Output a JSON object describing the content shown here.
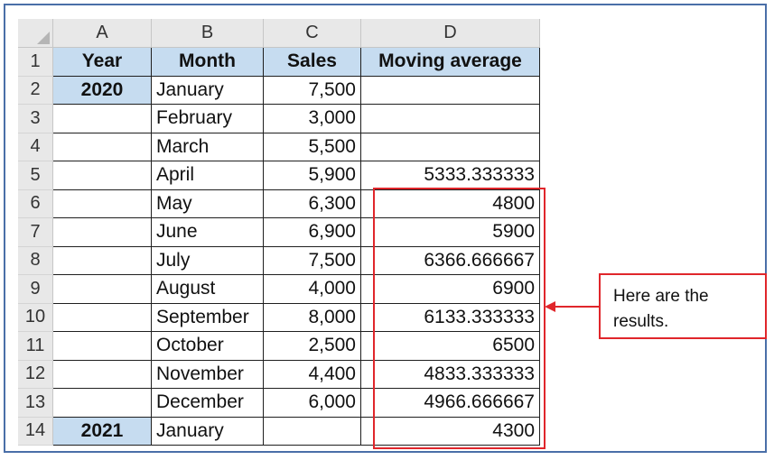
{
  "columns": [
    "A",
    "B",
    "C",
    "D"
  ],
  "headers": {
    "year": "Year",
    "month": "Month",
    "sales": "Sales",
    "moving_average": "Moving average"
  },
  "rows": [
    {
      "num": "2",
      "year": "2020",
      "month": "January",
      "sales": "7,500",
      "avg": ""
    },
    {
      "num": "3",
      "year": "",
      "month": "February",
      "sales": "3,000",
      "avg": ""
    },
    {
      "num": "4",
      "year": "",
      "month": "March",
      "sales": "5,500",
      "avg": ""
    },
    {
      "num": "5",
      "year": "",
      "month": "April",
      "sales": "5,900",
      "avg": "5333.333333"
    },
    {
      "num": "6",
      "year": "",
      "month": "May",
      "sales": "6,300",
      "avg": "4800"
    },
    {
      "num": "7",
      "year": "",
      "month": "June",
      "sales": "6,900",
      "avg": "5900"
    },
    {
      "num": "8",
      "year": "",
      "month": "July",
      "sales": "7,500",
      "avg": "6366.666667"
    },
    {
      "num": "9",
      "year": "",
      "month": "August",
      "sales": "4,000",
      "avg": "6900"
    },
    {
      "num": "10",
      "year": "",
      "month": "September",
      "sales": "8,000",
      "avg": "6133.333333"
    },
    {
      "num": "11",
      "year": "",
      "month": "October",
      "sales": "2,500",
      "avg": "6500"
    },
    {
      "num": "12",
      "year": "",
      "month": "November",
      "sales": "4,400",
      "avg": "4833.333333"
    },
    {
      "num": "13",
      "year": "",
      "month": "December",
      "sales": "6,000",
      "avg": "4966.666667"
    },
    {
      "num": "14",
      "year": "2021",
      "month": "January",
      "sales": "",
      "avg": "4300"
    }
  ],
  "header_row_num": "1",
  "callout": {
    "text": "Here are the results."
  },
  "colors": {
    "header_fill": "#c6dcf0",
    "highlight": "#e0262b",
    "frame": "#4a6fa8"
  }
}
